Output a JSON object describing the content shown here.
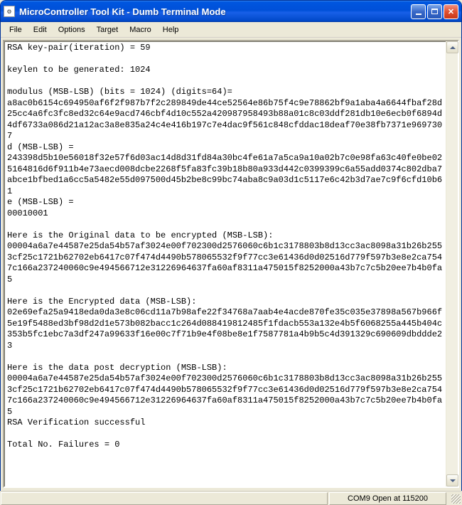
{
  "window": {
    "title": "MicroController Tool Kit - Dumb Terminal Mode"
  },
  "menu": {
    "items": [
      "File",
      "Edit",
      "Options",
      "Target",
      "Macro",
      "Help"
    ]
  },
  "terminal": {
    "lines": [
      "RSA key-pair(iteration) = 59",
      "",
      "keylen to be generated: 1024",
      "",
      "modulus (MSB-LSB) (bits = 1024) (digits=64)=",
      "a8ac0b6154c694950af6f2f987b7f2c289849de44ce52564e86b75f4c9e78862bf9a1aba4a6644fbaf28d25cc4a6fc3fc8ed32c64e9acd746cbf4d10c552a420987958493b88a01c8c03ddf281db10e6ecb0f6894d4df6733a086d21a12ac3a8e835a24c4e416b197c7e4dac9f561c848cfddac18deaf70e38fb7371e9697307",
      "d (MSB-LSB) =",
      "243398d5b10e56018f32e57f6d03ac14d8d31fd84a30bc4fe61a7a5ca9a10a02b7c0e98fa63c40fe0be025164816d6f911b4e73aecd008dcbe2268f5fa83fc39b18b80a933d442c0399399c6a55add0374c802dba7abce1bfbed1a6cc5a5482e55d097500d45b2be8c99bc74aba8c9a03d1c5117e6c42b3d7ae7c9f6cfd10b61",
      "e (MSB-LSB) =",
      "00010001",
      "",
      "Here is the Original data to be encrypted (MSB-LSB):",
      "00004a6a7e44587e25da54b57af3024e00f702300d2576060c6b1c3178803b8d13cc3ac8098a31b26b2553cf25c1721b62702eb6417c07f474d4490b578065532f9f77cc3e61436d0d02516d779f597b3e8e2ca7547c166a237240060c9e494566712e31226964637fa60af8311a475015f8252000a43b7c7c5b20ee7b4b0fa5",
      "",
      "Here is the Encrypted data (MSB-LSB):",
      "02e69efa25a9418eda0da3e8c06cd11a7b98afe22f34768a7aab4e4acde870fe35c035e37898a567b966f5e19f5488ed3bf98d2d1e573b082bacc1c264d088419812485f1fdacb553a132e4b5f6068255a445b404c353b5fc1ebc7a3df247a99633f16e00c7f71b9e4f08be8e1f7587781a4b9b5c4d391329c690609dbddde23",
      "",
      "Here is the data post decryption (MSB-LSB):",
      "00004a6a7e44587e25da54b57af3024e00f702300d2576060c6b1c3178803b8d13cc3ac8098a31b26b2553cf25c1721b62702eb6417c07f474d4490b578065532f9f77cc3e61436d0d02516d779f597b3e8e2ca7547c166a237240060c9e494566712e31226964637fa60af8311a475015f8252000a43b7c7c5b20ee7b4b0fa5",
      "RSA Verification successful",
      "",
      "Total No. Failures = 0",
      ""
    ]
  },
  "statusbar": {
    "connection": "COM9 Open at 115200"
  }
}
